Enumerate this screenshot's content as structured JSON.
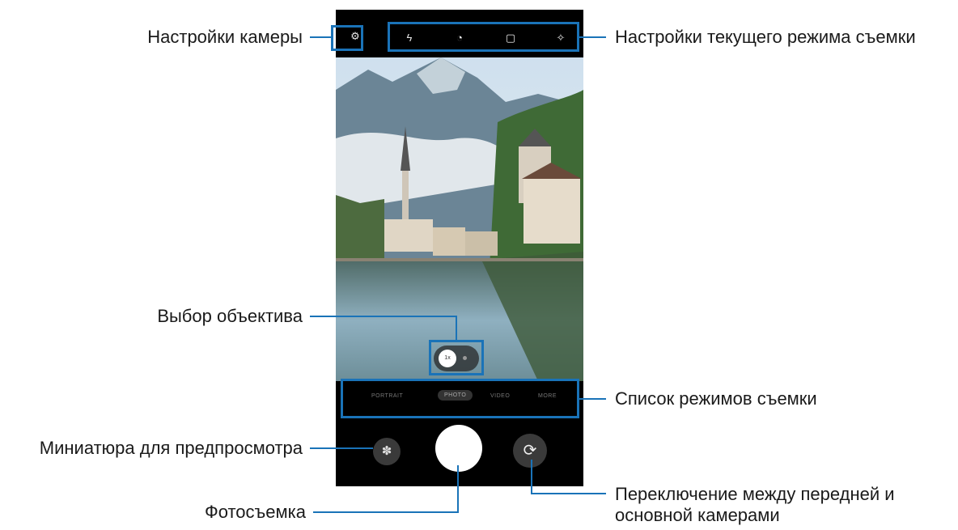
{
  "labels": {
    "camera_settings": "Настройки камеры",
    "current_mode_settings": "Настройки текущего режима съемки",
    "lens_selection": "Выбор объектива",
    "mode_list": "Список режимов съемки",
    "preview_thumbnail": "Миниатюра для предпросмотра",
    "camera_switch_line1": "Переключение между передней и",
    "camera_switch_line2": "основной камерами",
    "take_photo": "Фотосъемка"
  },
  "phone": {
    "modes": [
      "PORTRAIT",
      "PHOTO",
      "VIDEO",
      "MORE"
    ],
    "active_mode": "PHOTO",
    "top_icons": [
      "gear-icon",
      "flash-icon",
      "timer-icon",
      "ratio-icon",
      "effects-icon"
    ]
  },
  "colors": {
    "callout": "#1a73b8"
  }
}
